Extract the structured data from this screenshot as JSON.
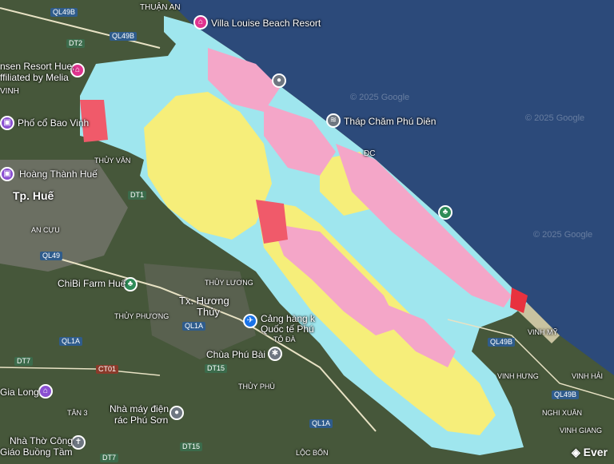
{
  "places": {
    "thuan_an": "THUẬN AN",
    "villa_louise": "Villa Louise Beach Resort",
    "resort_hue": "nsen Resort Hue,",
    "resort_hue2": "ffiliated by Melia",
    "vinh": "VINH",
    "pho_co": "Phố cổ Bao Vinh",
    "thuy_van": "THỦY VÂN",
    "hoang_thanh": "Hoàng Thành Huế",
    "tp_hue": "Tp. Huế",
    "an_cuu": "AN CỰU",
    "chibi_farm": "ChiBi Farm Huế",
    "thuy_luong": "THỦY LƯƠNG",
    "tx_huong_thuy": "Tx. Hương",
    "tx_huong_thuy2": "Thủy",
    "thuy_phuong": "THỦY PHƯƠNG",
    "cang_hang_khong": "Cảng hàng k",
    "quoc_te_phu": "Quốc tế Phú",
    "to_da": "TÔ ĐÀ",
    "chua_phu_bai": "Chùa Phú Bài",
    "thap_cham": "Tháp Chăm Phú Diên",
    "thuy_phu": "THỦY PHÙ",
    "gia_long": "Gia Long",
    "tan3": "TÂN 3",
    "nha_may": "Nhà máy điện",
    "nha_may2": "rác Phú Sơn",
    "nha_tho": "Nhà Thờ Công",
    "nha_tho2": "Giáo Buồng Tầm",
    "loc_bon": "LỘC BỔN",
    "vinh_my": "VINH MỸ",
    "vinh_hung": "VINH HƯNG",
    "vinh_hai": "VINH HẢI",
    "nghi_xuan": "NGHI XUÂN",
    "vinh_giang": "VINH GIANG",
    "dc": "ĐC"
  },
  "roads": {
    "ql49b_top": "QL49B",
    "ql49b_2": "QL49B",
    "dt2": "DT2",
    "dt1": "DT1",
    "ql49": "QL49",
    "ql1a_1": "QL1A",
    "ql1a_2": "QL1A",
    "ql1a_3": "QL1A",
    "dt7": "DT7",
    "dt7b": "DT7",
    "ct01": "CT01",
    "dt15": "DT15",
    "dt15b": "DT15",
    "ql49b_e": "QL49B",
    "ql49b_f": "QL49B"
  },
  "watermarks": {
    "w1": "© 2025 Google",
    "w2": "© 2025 Google",
    "w3": "© 2025 Google"
  },
  "brand": "◈ Ever",
  "colors": {
    "sea": "#2c4a7a",
    "lagoon": "#9fe6ee",
    "residential": "#f4a6c8",
    "agri": "#f6ee7a",
    "urban": "#f05a6a"
  }
}
